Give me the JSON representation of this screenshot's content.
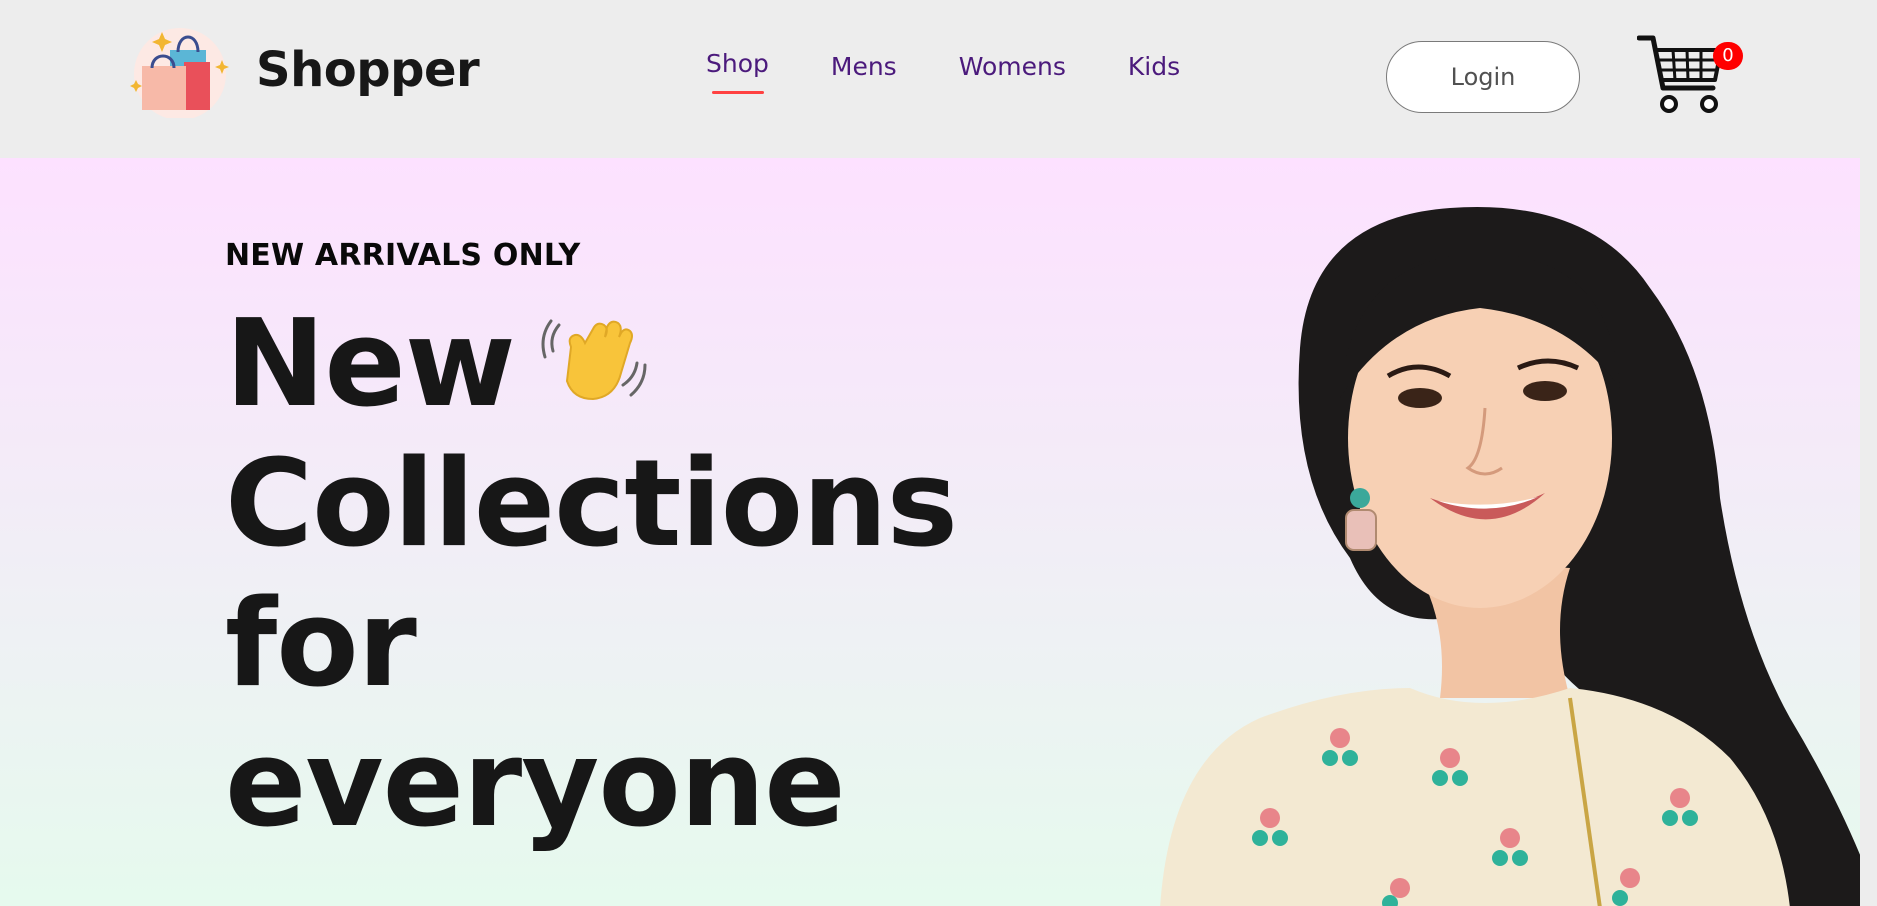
{
  "brand": {
    "name": "Shopper",
    "logo_icon": "shopping-bags-icon"
  },
  "nav": {
    "items": [
      {
        "label": "Shop",
        "active": true
      },
      {
        "label": "Mens",
        "active": false
      },
      {
        "label": "Womens",
        "active": false
      },
      {
        "label": "Kids",
        "active": false
      }
    ]
  },
  "header": {
    "login_label": "Login",
    "cart_icon": "cart-icon",
    "cart_count": "0"
  },
  "hero": {
    "eyebrow": "NEW ARRIVALS ONLY",
    "title_lines": [
      "New",
      "Collections",
      "for",
      "everyone"
    ],
    "hand_icon": "waving-hand-icon",
    "image": "smiling-woman-photo"
  },
  "colors": {
    "nav_text": "#4b1a7c",
    "accent_underline": "#ff4141",
    "cart_badge": "#ff0000",
    "hero_gradient_top": "#fde1ff",
    "hero_gradient_bottom": "#e1ffea",
    "header_bg": "#ededed"
  }
}
